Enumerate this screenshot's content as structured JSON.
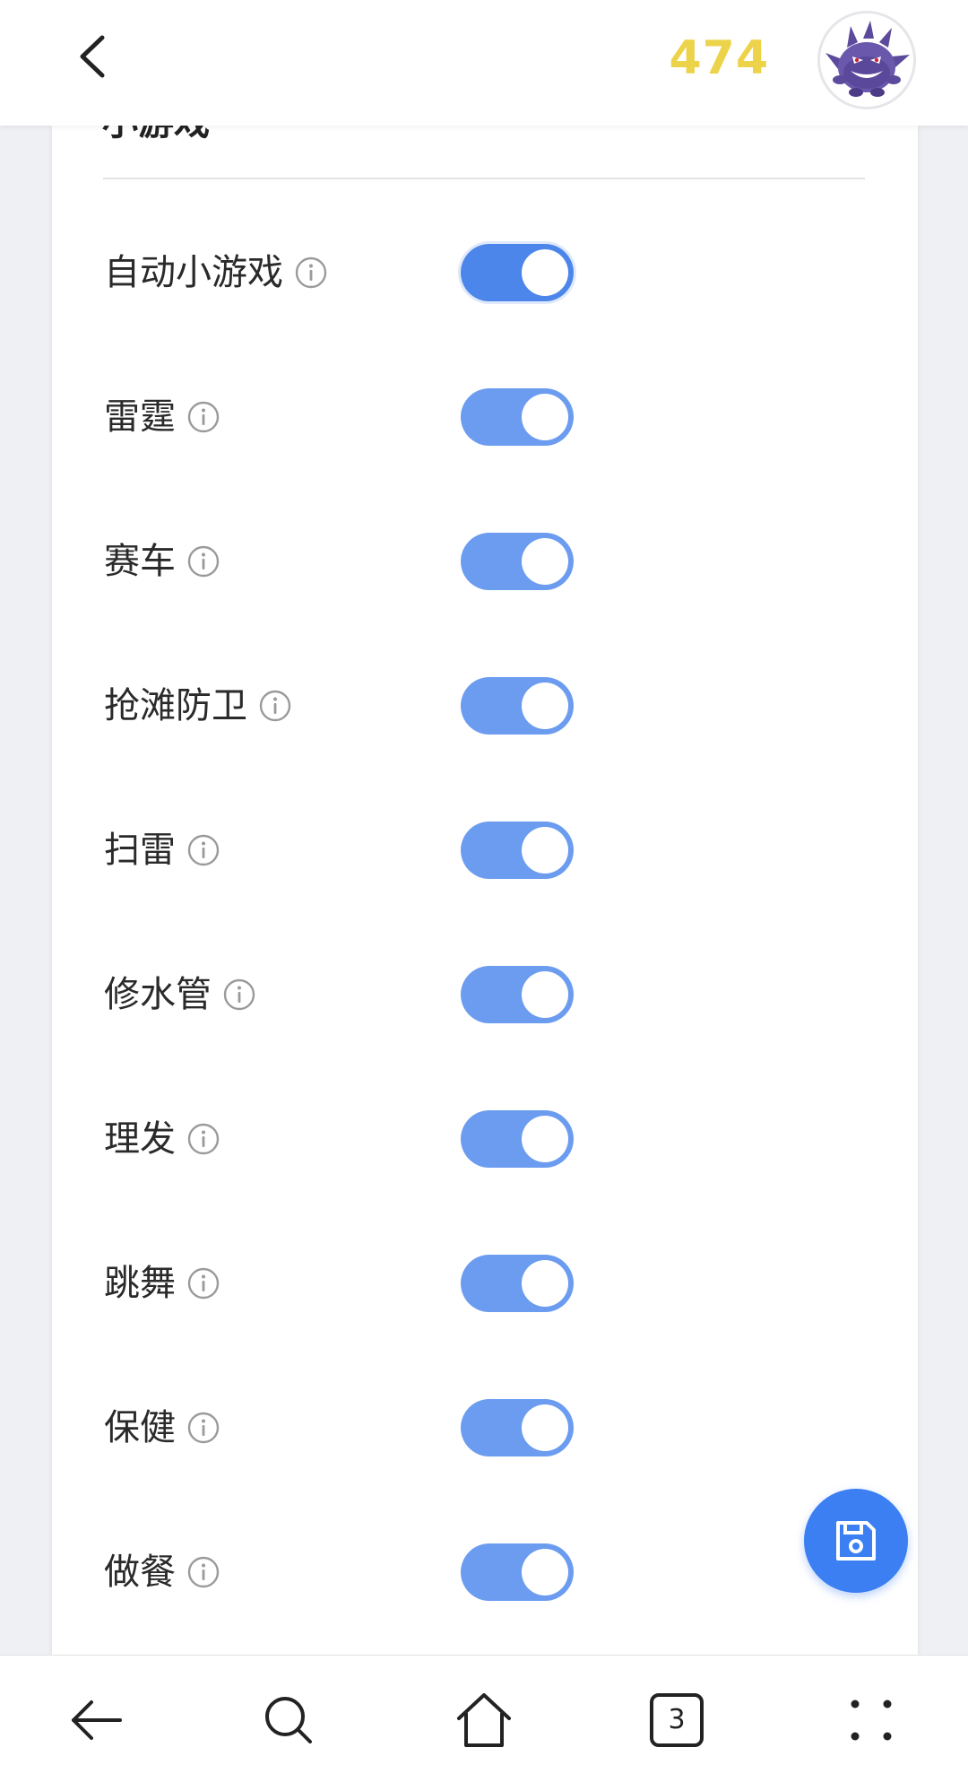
{
  "header": {
    "coins": "474"
  },
  "section": {
    "title": "小游戏"
  },
  "settings": [
    {
      "label": "自动小游戏",
      "enabled": true,
      "primary": true
    },
    {
      "label": "雷霆",
      "enabled": true
    },
    {
      "label": "赛车",
      "enabled": true
    },
    {
      "label": "抢滩防卫",
      "enabled": true
    },
    {
      "label": "扫雷",
      "enabled": true
    },
    {
      "label": "修水管",
      "enabled": true
    },
    {
      "label": "理发",
      "enabled": true
    },
    {
      "label": "跳舞",
      "enabled": true
    },
    {
      "label": "保健",
      "enabled": true
    },
    {
      "label": "做餐",
      "enabled": true
    }
  ],
  "bottom_nav": {
    "tab_count": "3"
  },
  "colors": {
    "coin": "#ecd34a",
    "toggle_on": "#6b9cf0",
    "toggle_primary": "#4d86ea",
    "fab": "#3b7ff2"
  },
  "icons": {
    "back": "chevron-left-icon",
    "avatar": "gengar-avatar",
    "info": "info-icon",
    "save": "floppy-disk-icon",
    "nav_back": "arrow-left-icon",
    "nav_search": "search-icon",
    "nav_home": "home-icon",
    "nav_tabs": "tabs-icon",
    "nav_menu": "menu-dots-icon"
  }
}
